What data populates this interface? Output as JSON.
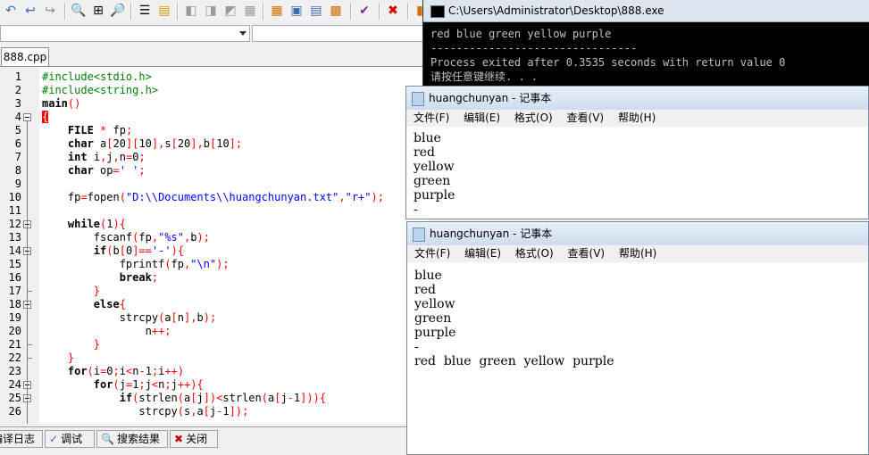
{
  "toolbar": {
    "icons": [
      "undo-icon",
      "redo-icon",
      "print-preview-icon",
      "zoom-icon",
      "list-icon",
      "align-icon",
      "back-icon",
      "forward-icon",
      "home-icon",
      "grid-icon",
      "window-icon",
      "tiles-icon",
      "check-icon",
      "close-icon",
      "chart-icon"
    ]
  },
  "editor": {
    "tab_label": "888.cpp",
    "line_numbers": [
      "1",
      "2",
      "3",
      "4",
      "5",
      "6",
      "7",
      "8",
      "9",
      "10",
      "11",
      "12",
      "13",
      "14",
      "15",
      "16",
      "17",
      "18",
      "19",
      "20",
      "21",
      "22",
      "23",
      "24",
      "25",
      "26"
    ],
    "lines": [
      "#include<stdio.h>",
      "#include<string.h>",
      "main()",
      "{",
      "    FILE * fp;",
      "    char a[20][10],s[20],b[10];",
      "    int i,j,n=0;",
      "    char op=' ';",
      "",
      "    fp=fopen(\"D:\\\\Documents\\\\huangchunyan.txt\",\"r+\");",
      "",
      "    while(1){",
      "        fscanf(fp,\"%s\",b);",
      "        if(b[0]=='-'){",
      "            fprintf(fp,\"\\n\");",
      "            break;",
      "        }",
      "        else{",
      "            strcpy(a[n],b);",
      "                n++;",
      "        }",
      "    }",
      "    for(i=0;i<n-1;i++)",
      "        for(j=1;j<n;j++){",
      "            if(strlen(a[j])<strlen(a[j-1])){",
      "               strcpy(s,a[j-1]);"
    ]
  },
  "bottom_tabs": [
    {
      "label": "编译日志"
    },
    {
      "label": "调试"
    },
    {
      "label": "搜索结果"
    },
    {
      "label": "关闭"
    }
  ],
  "console": {
    "title": "C:\\Users\\Administrator\\Desktop\\888.exe",
    "lines": [
      "red blue green yellow purple",
      "--------------------------------",
      "Process exited after 0.3535 seconds with return value 0",
      "请按任意键继续. . ."
    ]
  },
  "notepad_back": {
    "title": "huangchunyan - 记事本",
    "menu": [
      "文件(F)",
      "编辑(E)",
      "格式(O)",
      "查看(V)",
      "帮助(H)"
    ],
    "lines": [
      "blue",
      "red",
      "yellow",
      "green",
      "purple",
      "-"
    ]
  },
  "notepad_front": {
    "title": "huangchunyan - 记事本",
    "menu": [
      "文件(F)",
      "编辑(E)",
      "格式(O)",
      "查看(V)",
      "帮助(H)"
    ],
    "lines": [
      "blue",
      "red",
      "yellow",
      "green",
      "purple",
      "-",
      "red  blue  green  yellow  purple"
    ]
  }
}
